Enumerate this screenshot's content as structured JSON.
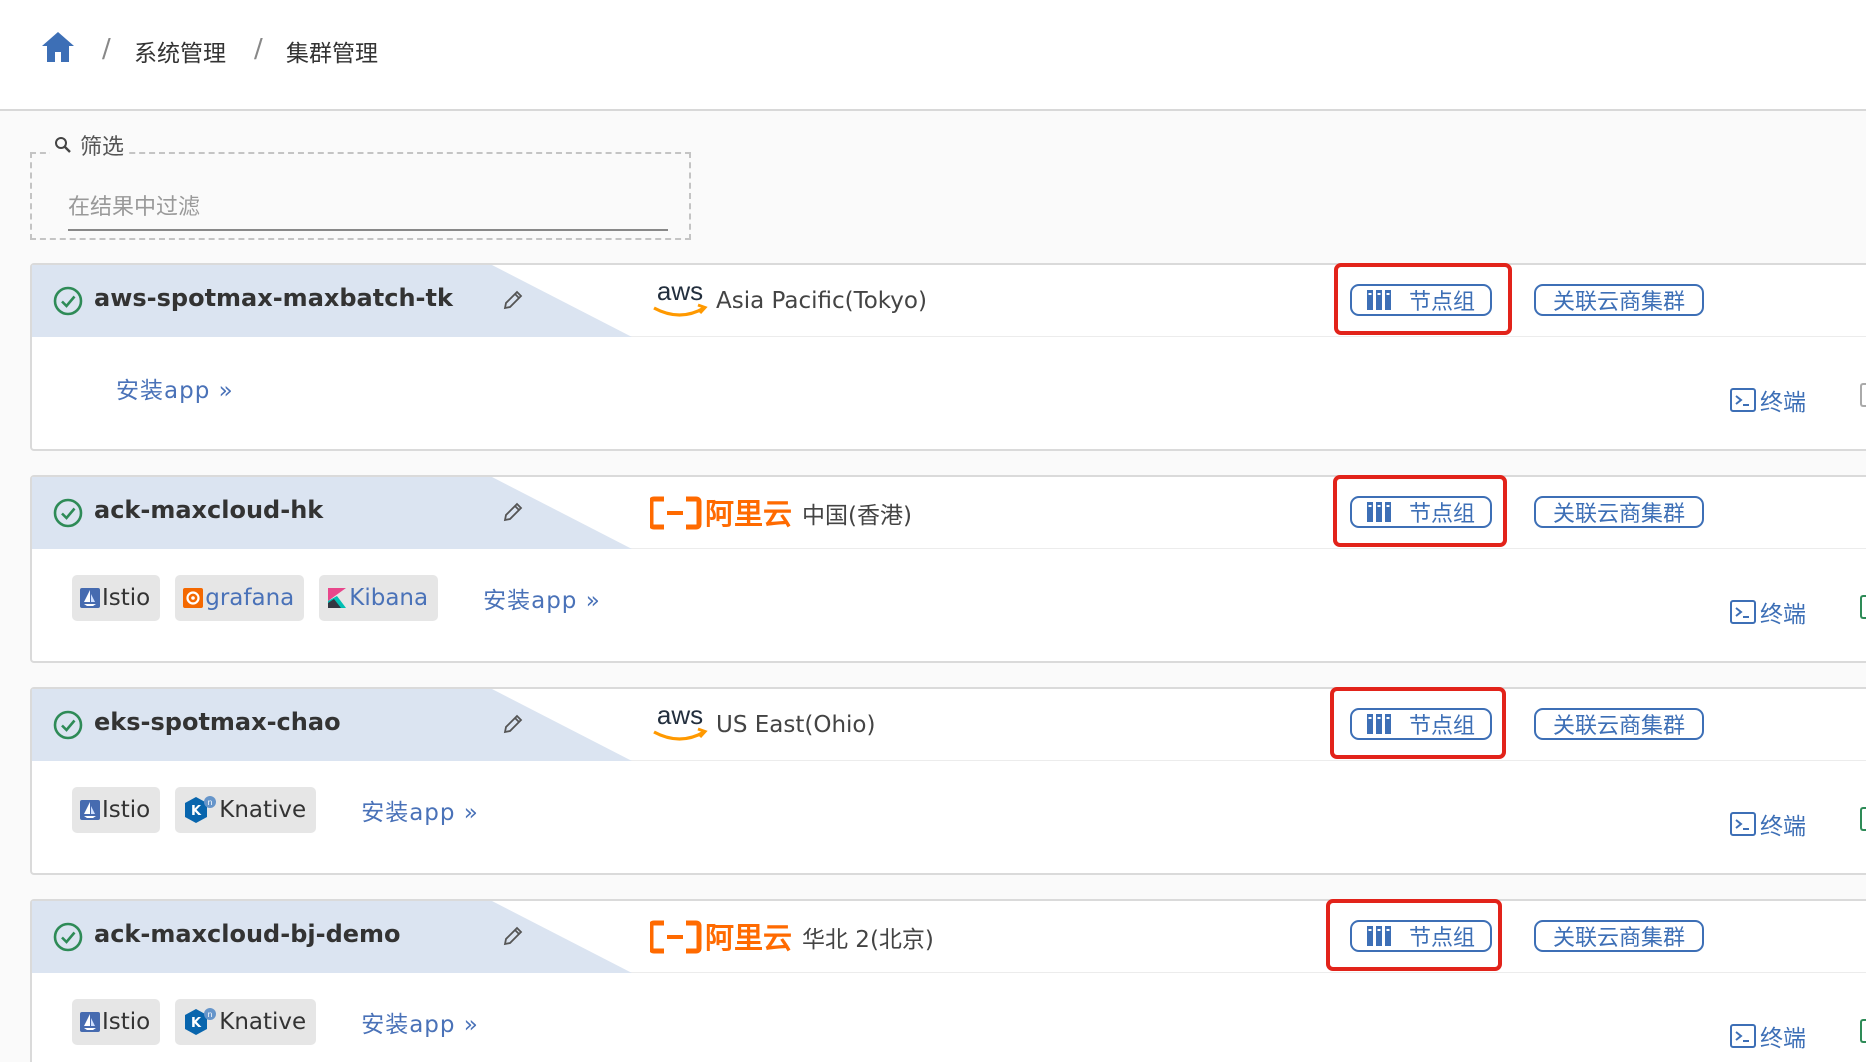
{
  "breadcrumb": {
    "items": [
      "系统管理",
      "集群管理"
    ],
    "separator": "/"
  },
  "filter": {
    "legend": "筛选",
    "placeholder": "在结果中过滤"
  },
  "colors": {
    "accent": "#3d6fb6",
    "highlight": "#e2231a",
    "success": "#2e8b57",
    "aws_orange": "#ff9900",
    "aliyun_orange": "#ff6a00",
    "name_bar": "#dbe4f1"
  },
  "clusters": [
    {
      "name": "aws-spotmax-maxbatch-tk",
      "provider": "aws",
      "provider_label": "aws",
      "region": "Asia Pacific(Tokyo)",
      "node_group_label": "节点组",
      "associate_label": "关联云商集群",
      "apps": [],
      "install_label": "安装app »",
      "terminal_label": "终端"
    },
    {
      "name": "ack-maxcloud-hk",
      "provider": "aliyun",
      "provider_label": "阿里云",
      "region": "中国(香港)",
      "node_group_label": "节点组",
      "associate_label": "关联云商集群",
      "apps": [
        {
          "label": "Istio",
          "icon": "istio-icon"
        },
        {
          "label": "grafana",
          "icon": "grafana-icon"
        },
        {
          "label": "Kibana",
          "icon": "kibana-icon"
        }
      ],
      "install_label": "安装app »",
      "terminal_label": "终端"
    },
    {
      "name": "eks-spotmax-chao",
      "provider": "aws",
      "provider_label": "aws",
      "region": "US East(Ohio)",
      "node_group_label": "节点组",
      "associate_label": "关联云商集群",
      "apps": [
        {
          "label": "Istio",
          "icon": "istio-icon"
        },
        {
          "label": "Knative",
          "icon": "knative-icon"
        }
      ],
      "install_label": "安装app »",
      "terminal_label": "终端"
    },
    {
      "name": "ack-maxcloud-bj-demo",
      "provider": "aliyun",
      "provider_label": "阿里云",
      "region": "华北 2(北京)",
      "node_group_label": "节点组",
      "associate_label": "关联云商集群",
      "apps": [
        {
          "label": "Istio",
          "icon": "istio-icon"
        },
        {
          "label": "Knative",
          "icon": "knative-icon"
        }
      ],
      "install_label": "安装app »",
      "terminal_label": "终端"
    }
  ]
}
